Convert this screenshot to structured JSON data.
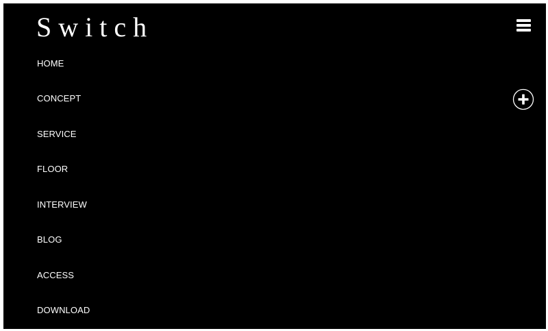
{
  "header": {
    "logo_text": "Switch",
    "menu_icon": "hamburger-menu-icon"
  },
  "nav": {
    "items": [
      {
        "label": "HOME"
      },
      {
        "label": "CONCEPT",
        "expand_icon": "plus-circle-icon"
      },
      {
        "label": "SERVICE"
      },
      {
        "label": "FLOOR"
      },
      {
        "label": "INTERVIEW"
      },
      {
        "label": "BLOG"
      },
      {
        "label": "ACCESS"
      },
      {
        "label": "DOWNLOAD"
      }
    ]
  },
  "colors": {
    "background": "#000000",
    "text": "#ffffff",
    "page_border": "#ffffff"
  }
}
